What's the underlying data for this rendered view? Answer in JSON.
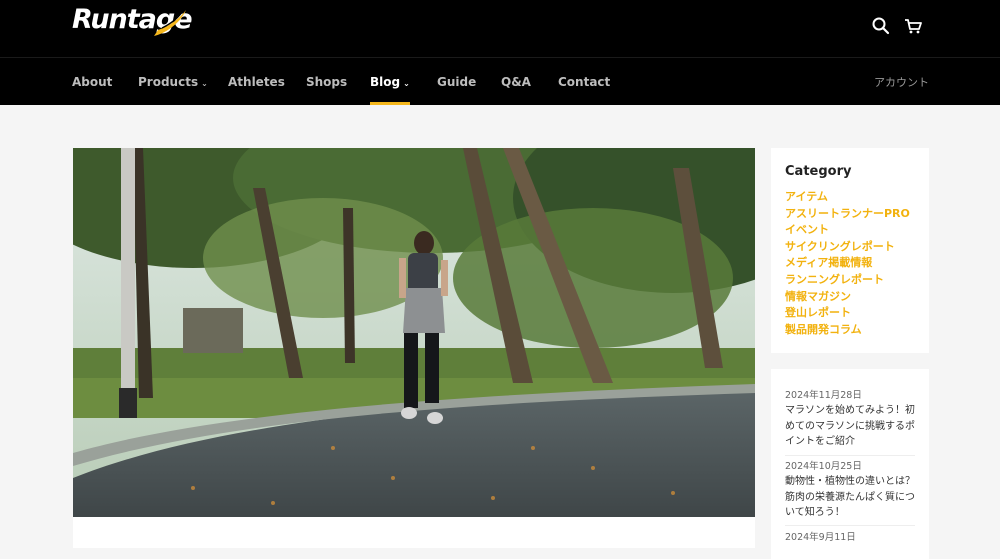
{
  "brand": {
    "name": "Runtage",
    "accent": "#f5b71c"
  },
  "header": {
    "icons": [
      "search-icon",
      "cart-icon"
    ]
  },
  "nav": {
    "items": [
      {
        "label": "About"
      },
      {
        "label": "Products",
        "dropdown": true
      },
      {
        "label": "Athletes"
      },
      {
        "label": "Shops"
      },
      {
        "label": "Blog",
        "dropdown": true,
        "active": true
      },
      {
        "label": "Guide"
      },
      {
        "label": "Q&A"
      },
      {
        "label": "Contact"
      }
    ],
    "account": "アカウント"
  },
  "hero": {
    "image": "woman jogging on a tree-lined park path"
  },
  "sidebar": {
    "category_title": "Category",
    "categories": [
      "アイテム",
      "アスリートランナーPRO",
      "イベント",
      "サイクリングレポート",
      "メディア掲載情報",
      "ランニングレポート",
      "情報マガジン",
      "登山レポート",
      "製品開発コラム"
    ],
    "posts": [
      {
        "date": "2024年11月28日",
        "title": "マラソンを始めてみよう！初めてのマラソンに挑戦するポイントをご紹介"
      },
      {
        "date": "2024年10月25日",
        "title": "動物性・植物性の違いとは？筋肉の栄養源たんぱく質について知ろう！"
      },
      {
        "date": "2024年9月11日",
        "title": ""
      }
    ]
  }
}
